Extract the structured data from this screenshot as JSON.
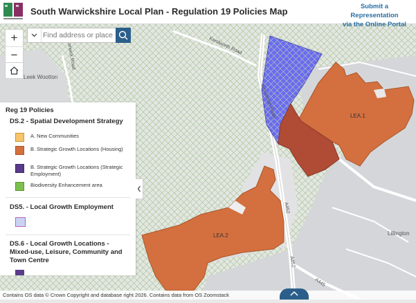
{
  "header": {
    "title": "South Warwickshire Local Plan - Regulation 19 Policies Map",
    "submit_line1": "Submit a Representation",
    "submit_line2": "via the Online Portal"
  },
  "search": {
    "placeholder": "Find address or place"
  },
  "zoom": {
    "in": "+",
    "out": "−"
  },
  "legend": {
    "title": "Reg 19 Policies",
    "sections": [
      {
        "title": "DS.2 - Spatial Development Strategy",
        "items": [
          {
            "label": "A. New Communities",
            "color": "#f6c469"
          },
          {
            "label": "B. Strategic Growth Locations (Housing)",
            "color": "#d4703f"
          },
          {
            "label": "B. Strategic Growth Locations (Strategic Employment)",
            "color": "#5a3b8a"
          },
          {
            "label": "Biodiversity Enhancement area",
            "color": "#7dbf4e"
          }
        ]
      },
      {
        "title": "DS5. - Local Growth Employment",
        "items": [
          {
            "label": "",
            "color": "#c58fe0"
          }
        ]
      },
      {
        "title": "DS.6 - Local Growth Locations - Mixed-use, Leisure, Community and Town Centre",
        "items": []
      }
    ]
  },
  "map_labels": {
    "lea1": "LEA.1",
    "lea2": "LEA.2",
    "leek_wootton": "Leek Wootton",
    "kenilworth_road": "Kenilworth Road",
    "warwick_road": "Warwick Road",
    "a452_a": "A452",
    "a452_b": "A452",
    "a445": "A445",
    "lillington": "Lillington"
  },
  "footer": {
    "attribution": "Contains OS data © Crown Copyright and database right 2026. Contains data from OS Zoomstack"
  },
  "colors": {
    "accent": "#2b5e8a",
    "housing": "#d4703f",
    "employment": "#6b6bf0",
    "hatch": "#9cbf8a"
  }
}
